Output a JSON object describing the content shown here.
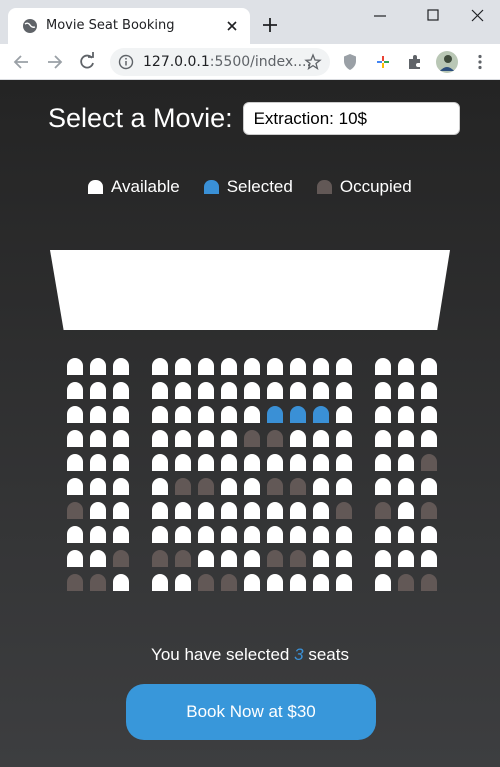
{
  "browser": {
    "tab_title": "Movie Seat Booking",
    "url_host": "127.0.0.1",
    "url_rest": ":5500/index...."
  },
  "page": {
    "picker_label": "Select a Movie:",
    "selected_movie": "Extraction: 10$",
    "legend": [
      "Available",
      "Selected",
      "Occupied"
    ],
    "summary_prefix": "You have selected",
    "selected_count": "3",
    "summary_suffix": "seats",
    "book_label": "Book Now at $30"
  },
  "colors": {
    "available": "#ffffff",
    "selected": "#3a90d6",
    "occupied": "#625856",
    "button": "#3897da"
  },
  "seats": {
    "columns": 16,
    "rows": [
      "AAAAAAAAAAAAAAAA",
      "AAAAAAAAAAAAAAAA",
      "AAAAAAAASSSAAAAA",
      "AAAAAAAOOAAAAAAA",
      "AAAAAAAAAAAAAAOO",
      "AAAAOOAAOOAAAAAA",
      "OAAAAAAAAAAOOAOO",
      "AAAAAAAAAAAAAAAA",
      "AAOOOAAAOOAAAAAA",
      "OOAAAOOAAAAAAOOA"
    ]
  }
}
